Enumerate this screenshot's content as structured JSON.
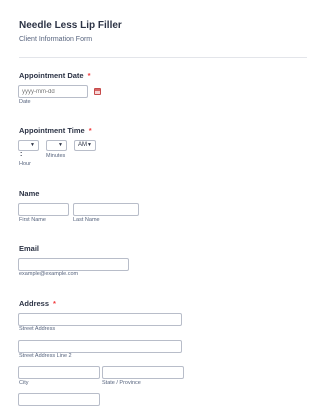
{
  "form": {
    "title": "Needle Less Lip Filler",
    "subtitle": "Client Information Form"
  },
  "appointment_date": {
    "label": "Appointment Date",
    "required_mark": "*",
    "placeholder": "yyyy-mm-dd",
    "sublabel": "Date",
    "icon": "calendar-icon"
  },
  "appointment_time": {
    "label": "Appointment Time",
    "required_mark": "*",
    "hour_value": "",
    "separator": ":",
    "minutes_value": "",
    "ampm_value": "AM",
    "hour_sublabel": "Hour",
    "minutes_sublabel": "Minutes",
    "arrow_icon": "▼"
  },
  "name": {
    "label": "Name",
    "first_sublabel": "First Name",
    "last_sublabel": "Last Name"
  },
  "email": {
    "label": "Email",
    "sublabel": "example@example.com"
  },
  "address": {
    "label": "Address",
    "required_mark": "*",
    "street_sublabel": "Street Address",
    "street2_sublabel": "Street Address Line 2",
    "city_sublabel": "City",
    "state_sublabel": "State / Province"
  },
  "colors": {
    "required": "#f23a3c",
    "text": "#2c3345",
    "sublabel": "#57647e"
  }
}
